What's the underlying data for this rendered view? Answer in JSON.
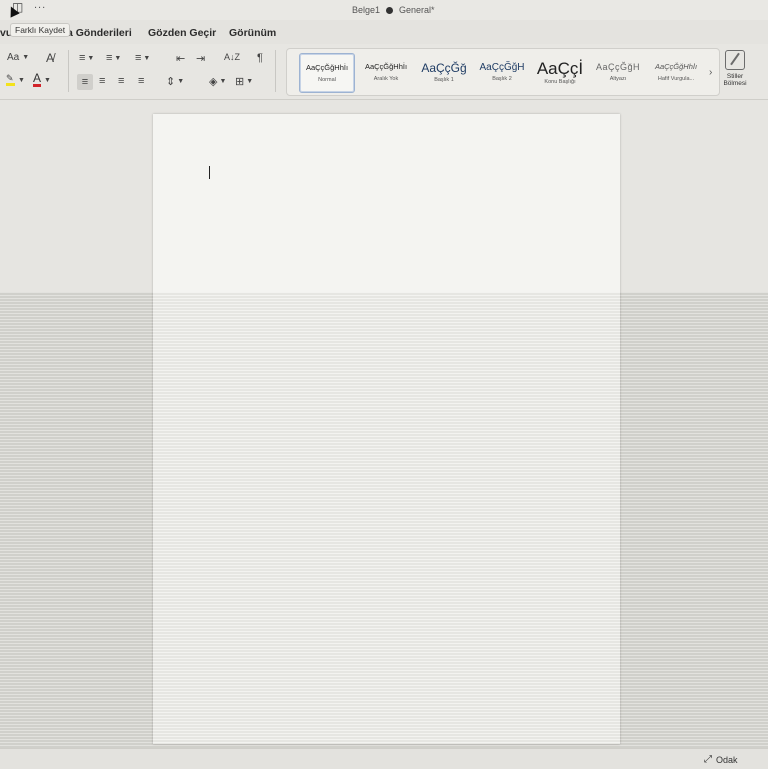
{
  "window": {
    "title": "Belge1",
    "sensitivity_label": "General*"
  },
  "quick_access": {
    "tooltip": "Farklı Kaydet",
    "more": "..."
  },
  "tabs": [
    {
      "label": "vur"
    },
    {
      "label": "a Gönderileri"
    },
    {
      "label": "Gözden Geçir"
    },
    {
      "label": "Görünüm"
    }
  ],
  "ribbon": {
    "font_size_label": "Aa",
    "paragraph_mark": "¶",
    "sort_label": "A↓Z",
    "styles_pane_label": "Stiller Bölmesi",
    "styles": [
      {
        "sample": "AaÇçĞğHhİı",
        "name": "Normal",
        "active": true
      },
      {
        "sample": "AaÇçĞğHhİı",
        "name": "Aralık Yok",
        "active": false
      },
      {
        "sample": "AaÇçĞğ",
        "name": "Başlık 1",
        "active": false
      },
      {
        "sample": "AaÇçĞğH",
        "name": "Başlık 2",
        "active": false
      },
      {
        "sample": "AaÇçİ",
        "name": "Konu Başlığı",
        "active": false
      },
      {
        "sample": "AaÇçĞğH",
        "name": "Altyazı",
        "active": false
      },
      {
        "sample": "AaÇçĞğHhİı",
        "name": "Hafif Vurgula...",
        "active": false
      }
    ],
    "colors": {
      "highlight": "#f3e21b",
      "font_color": "#d2242a"
    }
  },
  "statusbar": {
    "focus_label": "Odak"
  }
}
